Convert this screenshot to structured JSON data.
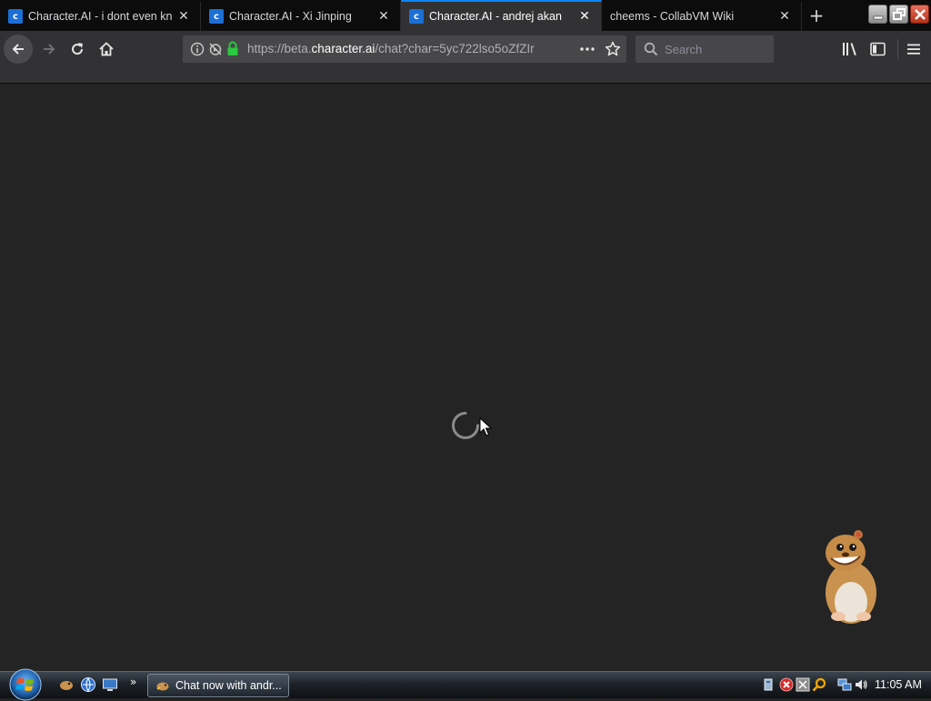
{
  "tabs": [
    {
      "title": "Character.AI - i dont even kno",
      "favicon": "character-ai-favicon",
      "active": false
    },
    {
      "title": "Character.AI - Xi Jinping",
      "favicon": "character-ai-favicon",
      "active": false
    },
    {
      "title": "Character.AI - andrej akan",
      "favicon": "character-ai-favicon",
      "active": true
    },
    {
      "title": "cheems - CollabVM Wiki",
      "favicon": "",
      "active": false
    }
  ],
  "address": {
    "prefix": "https://beta.",
    "domain": "character.ai",
    "path": "/chat?char=5yc722lso5oZfZIr"
  },
  "search": {
    "placeholder": "Search"
  },
  "taskbar": {
    "task_title": "Chat now with andr...",
    "clock": "11:05 AM"
  },
  "colors": {
    "accent": "#0a84ff",
    "page_bg": "#242424",
    "toolbar_bg": "#323234",
    "secure_lock": "#2ac940"
  }
}
